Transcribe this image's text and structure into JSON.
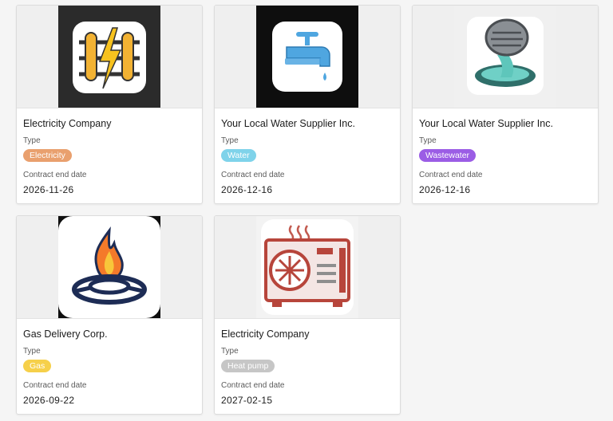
{
  "labels": {
    "type": "Type",
    "contract_end": "Contract end date"
  },
  "cards": [
    {
      "title": "Electricity Company",
      "type": "Electricity",
      "type_color": "#e9a06e",
      "end_date": "2026-11-26",
      "icon": "electricity-grid-icon"
    },
    {
      "title": "Your Local Water Supplier Inc.",
      "type": "Water",
      "type_color": "#7fd3ea",
      "end_date": "2026-12-16",
      "icon": "water-tap-icon"
    },
    {
      "title": "Your Local Water Supplier Inc.",
      "type": "Wastewater",
      "type_color": "#9b5de5",
      "end_date": "2026-12-16",
      "icon": "manhole-sewer-icon"
    },
    {
      "title": "Gas Delivery Corp.",
      "type": "Gas",
      "type_color": "#f6d04a",
      "end_date": "2026-09-22",
      "icon": "gas-flame-icon"
    },
    {
      "title": "Electricity Company",
      "type": "Heat pump",
      "type_color": "#c6c6c6",
      "end_date": "2027-02-15",
      "icon": "heat-pump-icon"
    }
  ]
}
